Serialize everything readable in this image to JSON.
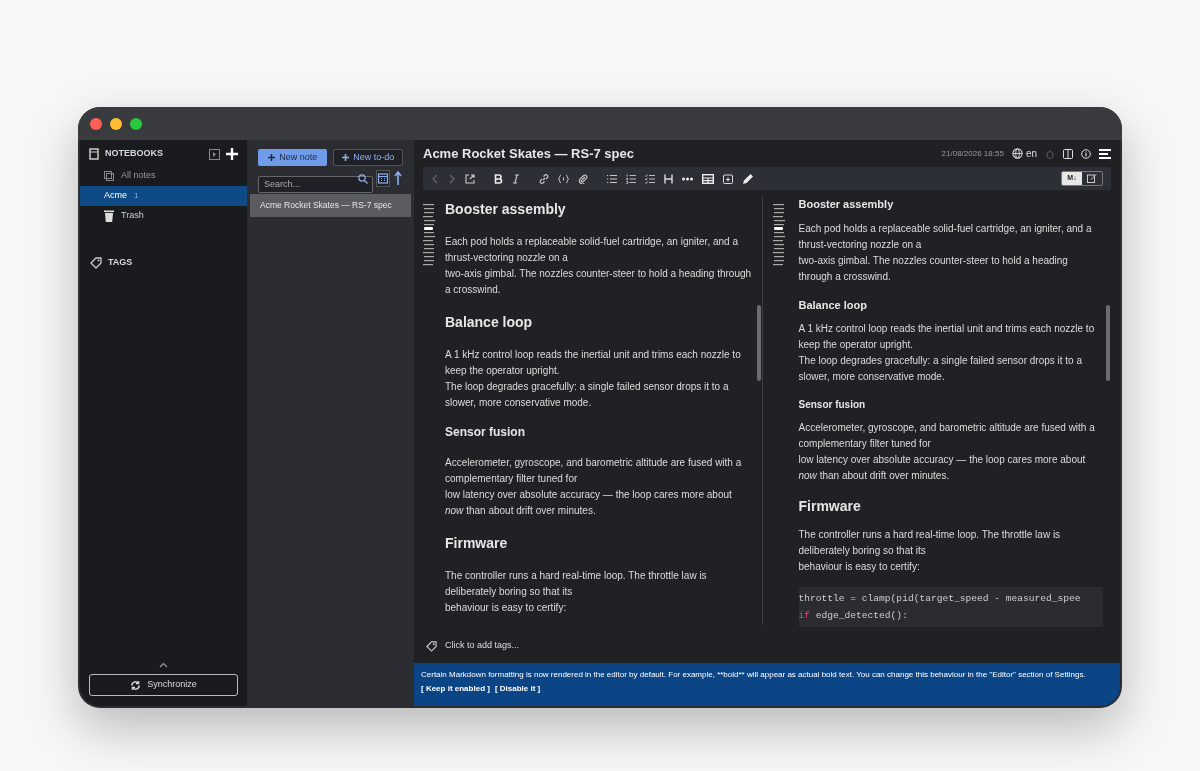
{
  "sidebar": {
    "header": "NOTEBOOKS",
    "items": [
      {
        "label": "All notes",
        "kind": "all",
        "selected": false
      },
      {
        "label": "Acme",
        "count": "1",
        "kind": "notebook",
        "selected": true
      },
      {
        "label": "Trash",
        "kind": "trash",
        "selected": false
      }
    ],
    "tags_header": "TAGS",
    "sync_button": "Synchronize"
  },
  "note_list": {
    "new_note": "New note",
    "new_todo": "New to-do",
    "search": {
      "placeholder": "Search..."
    },
    "notes": [
      {
        "title": "Acme Rocket Skates — RS-7 spec",
        "selected": true
      }
    ]
  },
  "editor": {
    "title": "Acme Rocket Skates — RS-7 spec",
    "timestamp": "21/08/2026 18:55",
    "language": "en",
    "view_toggle": [
      {
        "label": "M↓",
        "selected": true
      },
      {
        "kind": "edit",
        "selected": false
      }
    ],
    "panes": [
      {
        "kind": "editor",
        "blocks": [
          {
            "kind": "h2",
            "text": "Booster assembly"
          },
          {
            "kind": "p",
            "lines": [
              "Each pod holds a replaceable solid-fuel cartridge, an igniter, and a thrust-vectoring nozzle on a",
              "two-axis gimbal. The nozzles counter-steer to hold a heading through a crosswind."
            ]
          },
          {
            "kind": "h2",
            "text": "Balance loop"
          },
          {
            "kind": "p",
            "lines": [
              "A 1 kHz control loop reads the inertial unit and trims each nozzle to keep the operator upright.",
              "The loop degrades gracefully: a single failed sensor drops it to a slower, more conservative mode."
            ]
          },
          {
            "kind": "h3",
            "text": "Sensor fusion"
          },
          {
            "kind": "p",
            "lines": [
              "Accelerometer, gyroscope, and barometric altitude are fused with a complementary filter tuned for",
              "low latency over absolute accuracy — the loop cares more about",
              "*now* than about drift over minutes."
            ]
          },
          {
            "kind": "h2",
            "text": "Firmware"
          },
          {
            "kind": "p",
            "lines": [
              "The controller runs a hard real-time loop. The throttle law is deliberately boring so that its",
              "behaviour is easy to certify:"
            ]
          }
        ]
      },
      {
        "kind": "viewer",
        "blocks": [
          {
            "kind": "h3",
            "text": "Booster assembly"
          },
          {
            "kind": "p",
            "lines": [
              "Each pod holds a replaceable solid-fuel cartridge, an igniter, and a thrust-vectoring nozzle on a",
              "two-axis gimbal. The nozzles counter-steer to hold a heading through a crosswind."
            ]
          },
          {
            "kind": "h3",
            "text": "Balance loop"
          },
          {
            "kind": "p",
            "lines": [
              "A 1 kHz control loop reads the inertial unit and trims each nozzle to keep the operator upright.",
              "The loop degrades gracefully: a single failed sensor drops it to a slower, more conservative mode."
            ]
          },
          {
            "kind": "h4",
            "text": "Sensor fusion"
          },
          {
            "kind": "p",
            "lines": [
              "Accelerometer, gyroscope, and barometric altitude are fused with a complementary filter tuned for",
              "low latency over absolute accuracy — the loop cares more about",
              "*now* than about drift over minutes."
            ]
          },
          {
            "kind": "h2",
            "text": "Firmware"
          },
          {
            "kind": "p",
            "lines": [
              "The controller runs a hard real-time loop. The throttle law is deliberately boring so that its",
              "behaviour is easy to certify:"
            ]
          },
          {
            "kind": "code",
            "lines": [
              [
                {
                  "kind": "plain",
                  "text": "throttle = clamp(pid(target_speed - measured_spee"
                }
              ],
              [
                {
                  "kind": "keyword",
                  "text": "if"
                },
                {
                  "kind": "plain",
                  "text": " edge_detected():"
                }
              ]
            ]
          }
        ]
      }
    ],
    "tags_placeholder": "Click to add tags...",
    "banner": {
      "message": "Certain Markdown formatting is now rendered in the editor by default. For example, **bold** will appear as actual bold text. You can change this behaviour in the \"Editor\" section of Settings.",
      "actions": [
        "[ Keep it enabled ]",
        "[ Disable it ]"
      ]
    }
  }
}
